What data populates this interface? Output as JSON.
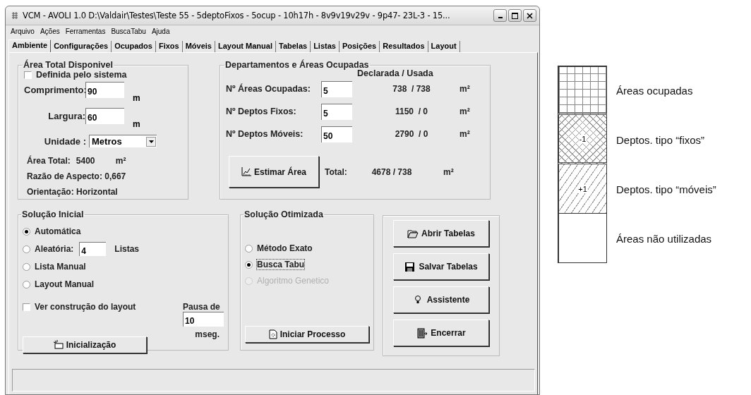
{
  "window": {
    "title": "VCM - AVOLI 1.0  D:\\Valdair\\Testes\\Teste 55 - 5deptoFixos - 5ocup - 10h17h - 8v9v19v29v - 9p47- 23L-3 - 15..."
  },
  "menu": [
    "Arquivo",
    "Ações",
    "Ferramentas",
    "BuscaTabu",
    "Ajuda"
  ],
  "tabs": [
    {
      "label": "Ambiente",
      "selected": true
    },
    {
      "label": "Configurações",
      "selected": false
    },
    {
      "label": "Ocupados",
      "selected": false
    },
    {
      "label": "Fixos",
      "selected": false
    },
    {
      "label": "Móveis",
      "selected": false
    },
    {
      "label": "Layout Manual",
      "selected": false
    },
    {
      "label": "Tabelas",
      "selected": false
    },
    {
      "label": "Listas",
      "selected": false
    },
    {
      "label": "Posições",
      "selected": false
    },
    {
      "label": "Resultados",
      "selected": false
    },
    {
      "label": "Layout",
      "selected": false
    }
  ],
  "area_total": {
    "title": "Área Total Disponivel",
    "auto": {
      "label": "Definida pelo sistema",
      "checked": false
    },
    "fields": [
      {
        "label": "Comprimento:",
        "value": "90",
        "unit": "m"
      },
      {
        "label": "Largura:",
        "value": "60",
        "unit": "m"
      }
    ],
    "unidade": {
      "label": "Unidade :",
      "value": "Metros"
    },
    "area": {
      "label": "Área Total:",
      "value": "5400",
      "unit": "m²"
    },
    "razao": "Razão de Aspecto: 0,667",
    "orientacao": "Orientação:  Horizontal"
  },
  "departamentos": {
    "title": "Departamentos e Áreas Ocupadas",
    "header": "Declarada / Usada",
    "rows": [
      {
        "label": "Nº Áreas Ocupadas:",
        "value": "5",
        "amount": "738  / 738",
        "unit": "m²"
      },
      {
        "label": "Nº Deptos Fixos:",
        "value": "5",
        "amount": "1150  / 0",
        "unit": "m²"
      },
      {
        "label": "Nº Deptos Móveis:",
        "value": "50",
        "amount": "2790  / 0",
        "unit": "m²"
      }
    ],
    "button": "Estimar Área",
    "total": {
      "label": "Total:",
      "amount": "4678 / 738",
      "unit": "m²"
    }
  },
  "solucao_inicial": {
    "title": "Solução Inicial",
    "options": [
      {
        "label": "Automática",
        "selected": true
      },
      {
        "label": "Aleatória:",
        "selected": false,
        "value": "4",
        "suffix": "Listas"
      },
      {
        "label": "Lista Manual",
        "selected": false
      },
      {
        "label": "Layout Manual",
        "selected": false
      }
    ],
    "checkbox": {
      "label": "Ver construção do layout",
      "checked": false
    },
    "pausa": {
      "label": "Pausa de",
      "value": "10",
      "unit": "mseg."
    },
    "button": "Inicialização"
  },
  "solucao_otimizada": {
    "title": "Solução Otimizada",
    "options": [
      {
        "label": "Método Exato",
        "selected": false,
        "disabled": false
      },
      {
        "label": "Busca Tabu",
        "selected": true,
        "disabled": false
      },
      {
        "label": "Algoritmo Genetico",
        "selected": false,
        "disabled": true
      }
    ],
    "button": "Iniciar Processo"
  },
  "actions": [
    {
      "label": "Abrir Tabelas",
      "kind": "open"
    },
    {
      "label": "Salvar Tabelas",
      "kind": "save"
    },
    {
      "label": "Assistente",
      "kind": "bulb"
    },
    {
      "label": "Encerrar",
      "kind": "exit"
    }
  ],
  "legend": [
    {
      "kind": "grid",
      "label": "Áreas ocupadas"
    },
    {
      "kind": "crosshatch",
      "mark": "-1",
      "label": "Deptos. tipo “fixos”"
    },
    {
      "kind": "diagonal",
      "mark": "+1",
      "label": "Deptos. tipo “móveis”"
    },
    {
      "kind": "blank",
      "label": "Áreas não utilizadas"
    }
  ]
}
